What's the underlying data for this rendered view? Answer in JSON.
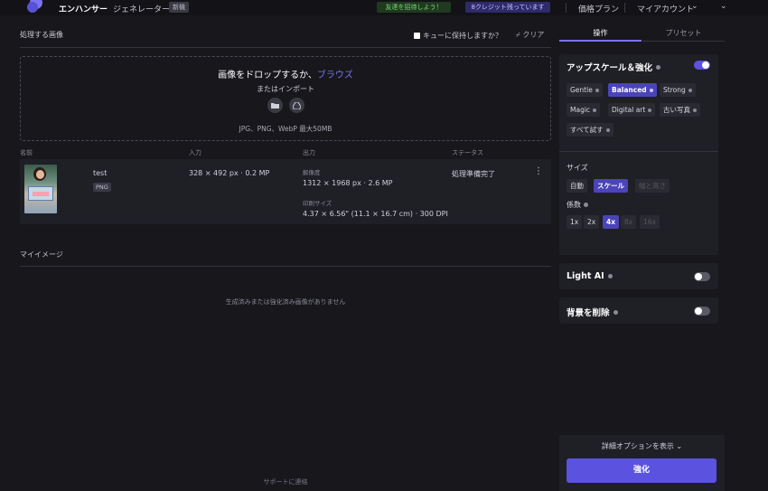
{
  "topbar": {
    "nav_enhancer": "エンハンサー",
    "nav_generator": "ジェネレーター",
    "badge_new": "新機",
    "invite": "友達を招待しよう！",
    "credits": "8クレジット残っています",
    "pricing": "価格プラン",
    "account": "マイアカウント"
  },
  "main": {
    "queue_title": "処理する画像",
    "keep_in_queue": "キューに保持しますか？",
    "clear": "クリア",
    "drop_title": "画像をドロップするか、",
    "drop_browse": "ブラウズ",
    "drop_or_import": "またはインポート",
    "formats": "JPG、PNG、WebP 最大50MB",
    "columns": {
      "name": "名前",
      "input": "入力",
      "output": "出力",
      "status": "ステータス"
    },
    "file": {
      "name": "test",
      "type": "PNG",
      "input": "328 × 492 px · 0.2 MP",
      "resolution_label": "解像度",
      "resolution": "1312 × 1968 px · 2.6 MP",
      "print_size_label": "印刷サイズ",
      "print_size": "4.37 × 6.56\" (11.1 × 16.7 cm) · 300 DPI",
      "status": "処理準備完了"
    },
    "my_images_title": "マイイメージ",
    "empty_msg": "生成済みまたは強化済み画像がありません",
    "support": "サポートに連絡"
  },
  "panel": {
    "tab_operations": "操作",
    "tab_presets": "プリセット",
    "upscale_title": "アップスケール＆強化",
    "models": [
      "Gentle",
      "Balanced",
      "Strong",
      "Magic",
      "Digital art",
      "古い写真",
      "すべて試す"
    ],
    "size_title": "サイズ",
    "size_modes": [
      "自動",
      "スケール",
      "幅と高さ"
    ],
    "factor_title": "係数",
    "factors": [
      "1x",
      "2x",
      "4x",
      "8x",
      "16x"
    ],
    "light_ai": "Light AI",
    "remove_bg": "背景を削除",
    "details": "詳細オプションを表示",
    "enhance": "強化"
  },
  "colors": {
    "accent": "#5b52e0",
    "accent_text": "#7b72f2",
    "background": "#17171c",
    "card": "#1f1f26"
  }
}
